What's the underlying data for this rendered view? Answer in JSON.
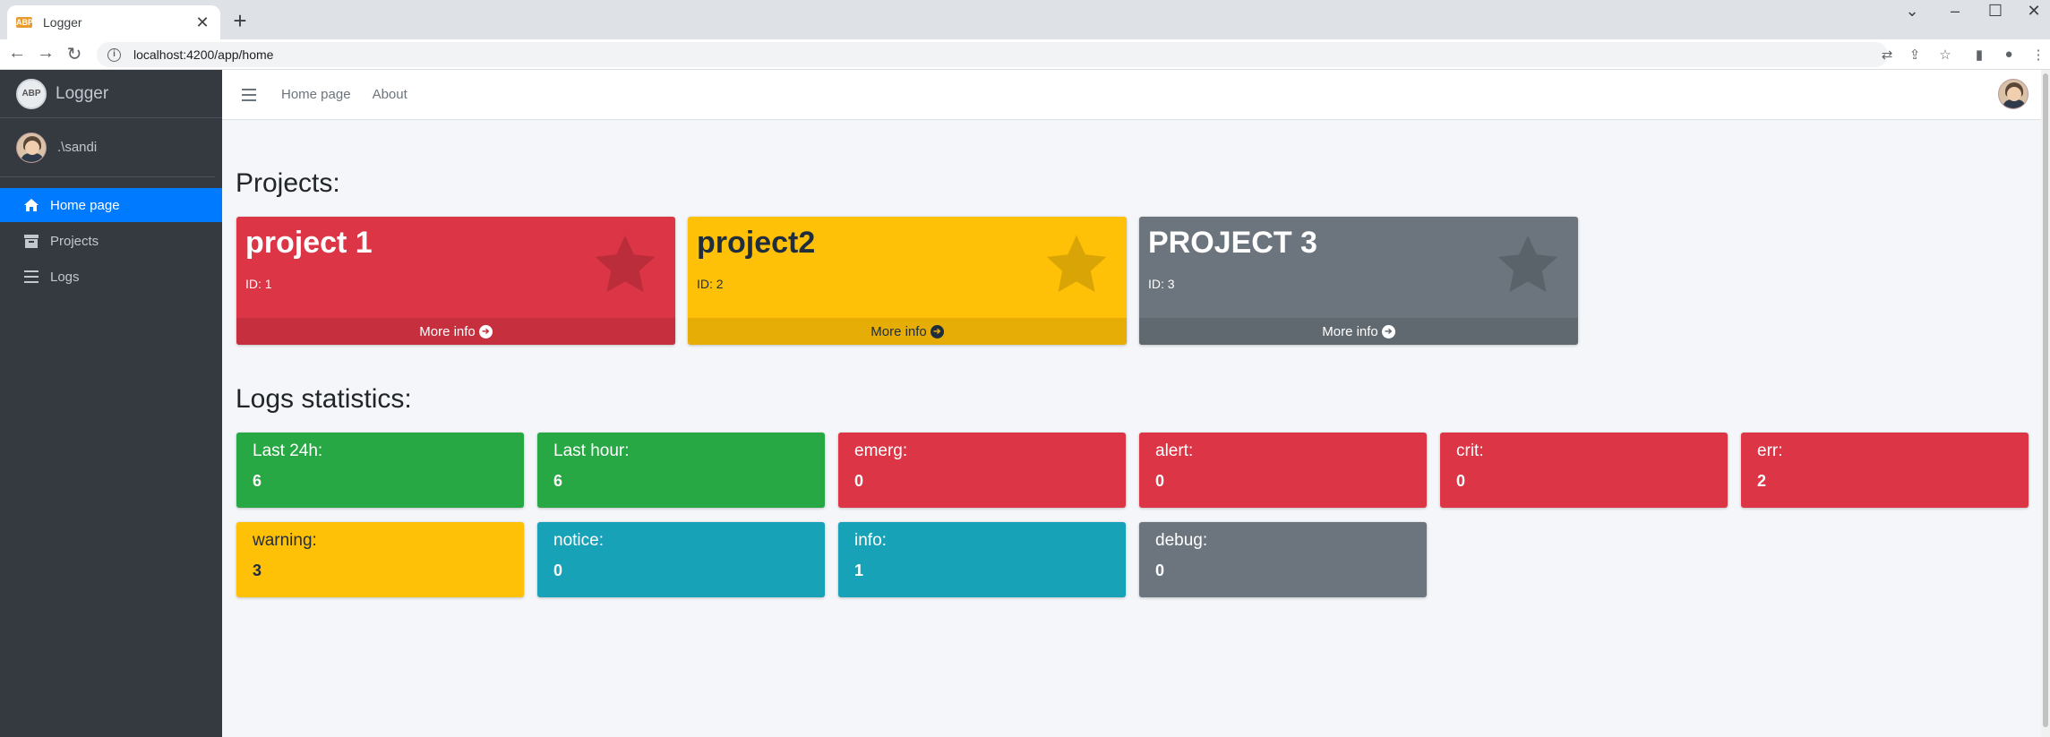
{
  "browser": {
    "tab_title": "Logger",
    "favicon_text": "ABP",
    "url": "localhost:4200/app/home",
    "new_tab": "+",
    "tab_close": "✕"
  },
  "sidebar": {
    "brand": "Logger",
    "brand_logo": "ABP",
    "user": ".\\sandi",
    "items": [
      {
        "label": "Home page",
        "icon": "home-icon",
        "active": true
      },
      {
        "label": "Projects",
        "icon": "archive-icon",
        "active": false
      },
      {
        "label": "Logs",
        "icon": "bars-icon",
        "active": false
      }
    ]
  },
  "topnav": {
    "links": [
      "Home page",
      "About"
    ]
  },
  "projects": {
    "title": "Projects:",
    "cards": [
      {
        "name": "project 1",
        "id": "ID: 1",
        "more": "More info",
        "color": "#dc3545"
      },
      {
        "name": "project2",
        "id": "ID: 2",
        "more": "More info",
        "color": "#ffc107"
      },
      {
        "name": "PROJECT 3",
        "id": "ID: 3",
        "more": "More info",
        "color": "#6c757d"
      }
    ]
  },
  "stats": {
    "title": "Logs statistics:",
    "cards": [
      {
        "label": "Last 24h:",
        "value": "6",
        "color": "#28a745"
      },
      {
        "label": "Last hour:",
        "value": "6",
        "color": "#28a745"
      },
      {
        "label": "emerg:",
        "value": "0",
        "color": "#dc3545"
      },
      {
        "label": "alert:",
        "value": "0",
        "color": "#dc3545"
      },
      {
        "label": "crit:",
        "value": "0",
        "color": "#dc3545"
      },
      {
        "label": "err:",
        "value": "2",
        "color": "#dc3545"
      },
      {
        "label": "warning:",
        "value": "3",
        "color": "#ffc107"
      },
      {
        "label": "notice:",
        "value": "0",
        "color": "#17a2b8"
      },
      {
        "label": "info:",
        "value": "1",
        "color": "#17a2b8"
      },
      {
        "label": "debug:",
        "value": "0",
        "color": "#6c757d"
      }
    ]
  }
}
